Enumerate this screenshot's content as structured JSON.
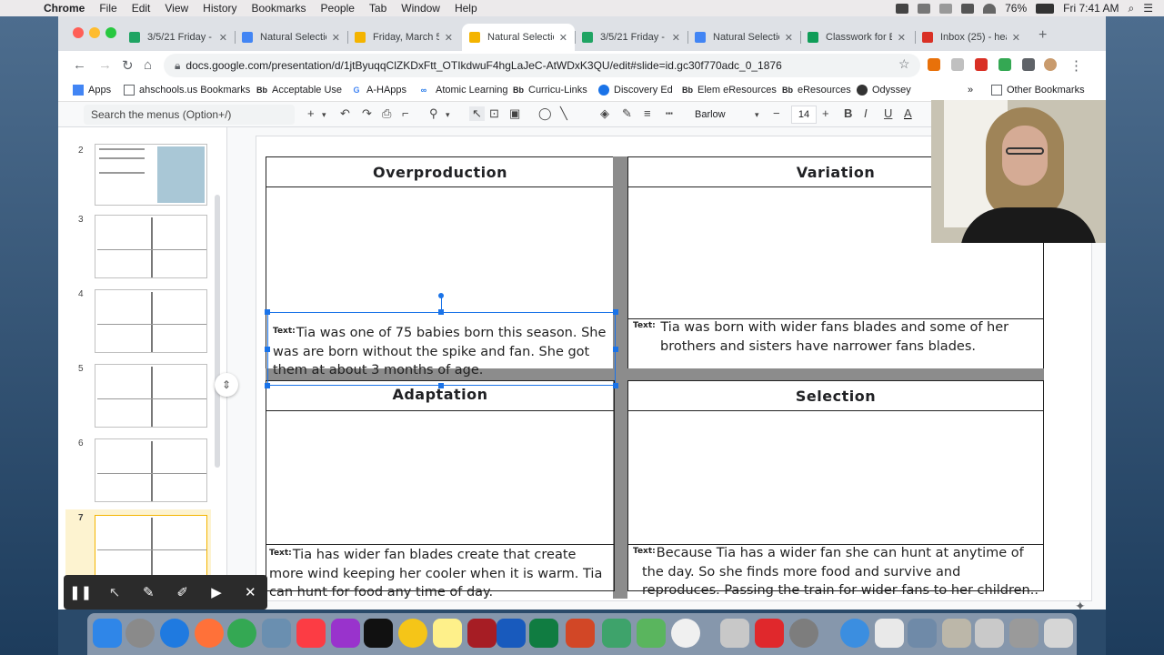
{
  "menubar": {
    "app": "Chrome",
    "items": [
      "File",
      "Edit",
      "View",
      "History",
      "Bookmarks",
      "People",
      "Tab",
      "Window",
      "Help"
    ],
    "battery": "76%",
    "clock": "Fri 7:41 AM"
  },
  "tabs": [
    {
      "label": "3/5/21 Friday - C",
      "icon": "google-drive-icon",
      "color": "#1fa463"
    },
    {
      "label": "Natural Selectio",
      "icon": "google-docs-icon",
      "color": "#4285f4"
    },
    {
      "label": "Friday, March 5",
      "icon": "google-slides-icon",
      "color": "#f4b400"
    },
    {
      "label": "Natural Selectio",
      "icon": "google-slides-icon",
      "color": "#f4b400",
      "active": true
    },
    {
      "label": "3/5/21 Friday - C",
      "icon": "google-drive-icon",
      "color": "#1fa463"
    },
    {
      "label": "Natural Selectio",
      "icon": "google-docs-icon",
      "color": "#4285f4"
    },
    {
      "label": "Classwork for B",
      "icon": "google-classroom-icon",
      "color": "#0f9d58"
    },
    {
      "label": "Inbox (25) - hea",
      "icon": "gmail-icon",
      "color": "#d93025"
    }
  ],
  "address": {
    "url": "docs.google.com/presentation/d/1jtByuqqClZKDxFtt_OTIkdwuF4hgLaJeC-AtWDxK3QU/edit#slide=id.gc30f770adc_0_1876"
  },
  "bookmarks": [
    {
      "label": "Apps",
      "icon": "apps-grid-icon"
    },
    {
      "label": "ahschools.us Bookmarks",
      "icon": "folder-icon"
    },
    {
      "label": "Acceptable Use",
      "icon": "blackboard-icon"
    },
    {
      "label": "A-HApps",
      "icon": "google-icon"
    },
    {
      "label": "Atomic Learning",
      "icon": "atomic-learning-icon"
    },
    {
      "label": "Curricu-Links",
      "icon": "blackboard-icon"
    },
    {
      "label": "Discovery Ed",
      "icon": "globe-icon"
    },
    {
      "label": "Elem eResources",
      "icon": "blackboard-icon"
    },
    {
      "label": "eResources",
      "icon": "blackboard-icon"
    },
    {
      "label": "Odyssey",
      "icon": "odyssey-icon"
    },
    {
      "label": "Other Bookmarks",
      "icon": "folder-icon"
    }
  ],
  "slides_toolbar": {
    "menu_search_placeholder": "Search the menus (Option+/)",
    "font": "Barlow",
    "font_size": "14"
  },
  "filmstrip": {
    "slides": [
      "2",
      "3",
      "4",
      "5",
      "6",
      "7"
    ],
    "selected": "7"
  },
  "slide": {
    "overproduction": {
      "title": "Overproduction",
      "label": "Text:",
      "text": "Tia was one of 75 babies born this  season.  She was  are born without the spike and fan.  She got them  at about 3 months of age."
    },
    "variation": {
      "title": "Variation",
      "label": "Text:",
      "text": "Tia was born with wider fans blades and some of her brothers and sisters  have narrower fans blades."
    },
    "adaptation": {
      "title": "Adaptation",
      "label": "Text:",
      "text": "Tia has wider fan blades create that create more  wind keeping her cooler when it is warm.  Tia can hunt for food any time of day."
    },
    "selection": {
      "title": "Selection",
      "label": "Text:",
      "text": "Because Tia has a wider fan she can  hunt at anytime of the day.  So she finds more food and survive and reproduces. Passing the train for wider fans to her children.."
    }
  },
  "recording_toolbar": {
    "buttons": [
      "pause-icon",
      "pointer-icon",
      "pen-icon",
      "highlighter-icon",
      "camera-icon",
      "close-icon"
    ]
  }
}
